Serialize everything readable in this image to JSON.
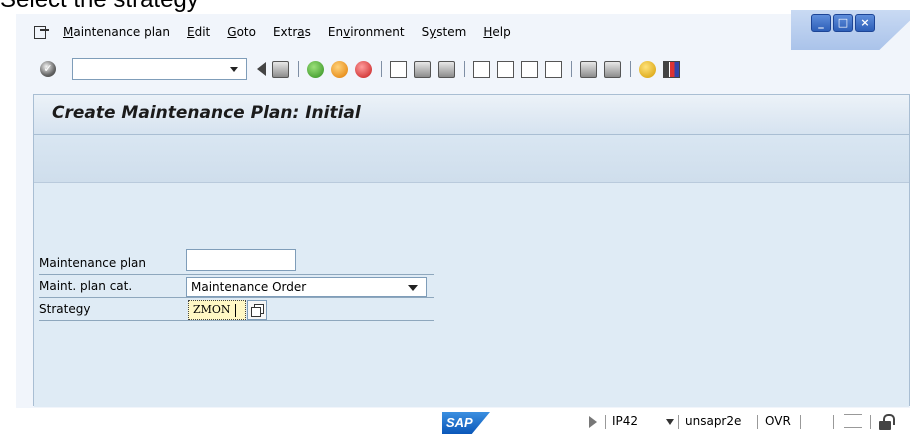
{
  "caption": "Select the strategy",
  "menu": [
    {
      "pre": "",
      "u": "M",
      "post": "aintenance plan"
    },
    {
      "pre": "",
      "u": "E",
      "post": "dit"
    },
    {
      "pre": "",
      "u": "G",
      "post": "oto"
    },
    {
      "pre": "Extr",
      "u": "a",
      "post": "s"
    },
    {
      "pre": "En",
      "u": "v",
      "post": "ironment"
    },
    {
      "pre": "S",
      "u": "y",
      "post": "stem"
    },
    {
      "pre": "",
      "u": "H",
      "post": "elp"
    }
  ],
  "window_buttons": [
    "minimize",
    "maximize",
    "close"
  ],
  "command_field": {
    "value": ""
  },
  "screen": {
    "title": "Create Maintenance Plan: Initial"
  },
  "form": {
    "maintenance_plan": {
      "label": "Maintenance plan",
      "value": ""
    },
    "plan_category": {
      "label": "Maint. plan cat.",
      "value": "Maintenance Order"
    },
    "strategy": {
      "label": "Strategy",
      "value": "ZMON"
    }
  },
  "status": {
    "logo": "SAP",
    "transaction": "IP42",
    "server": "unsapr2e",
    "mode": "OVR"
  },
  "colors": {
    "content_bg": "#dfebf5",
    "title_bar": "#d6e3f0",
    "focused_field": "#fff7c4",
    "sap_blue": "#0a57b9"
  }
}
